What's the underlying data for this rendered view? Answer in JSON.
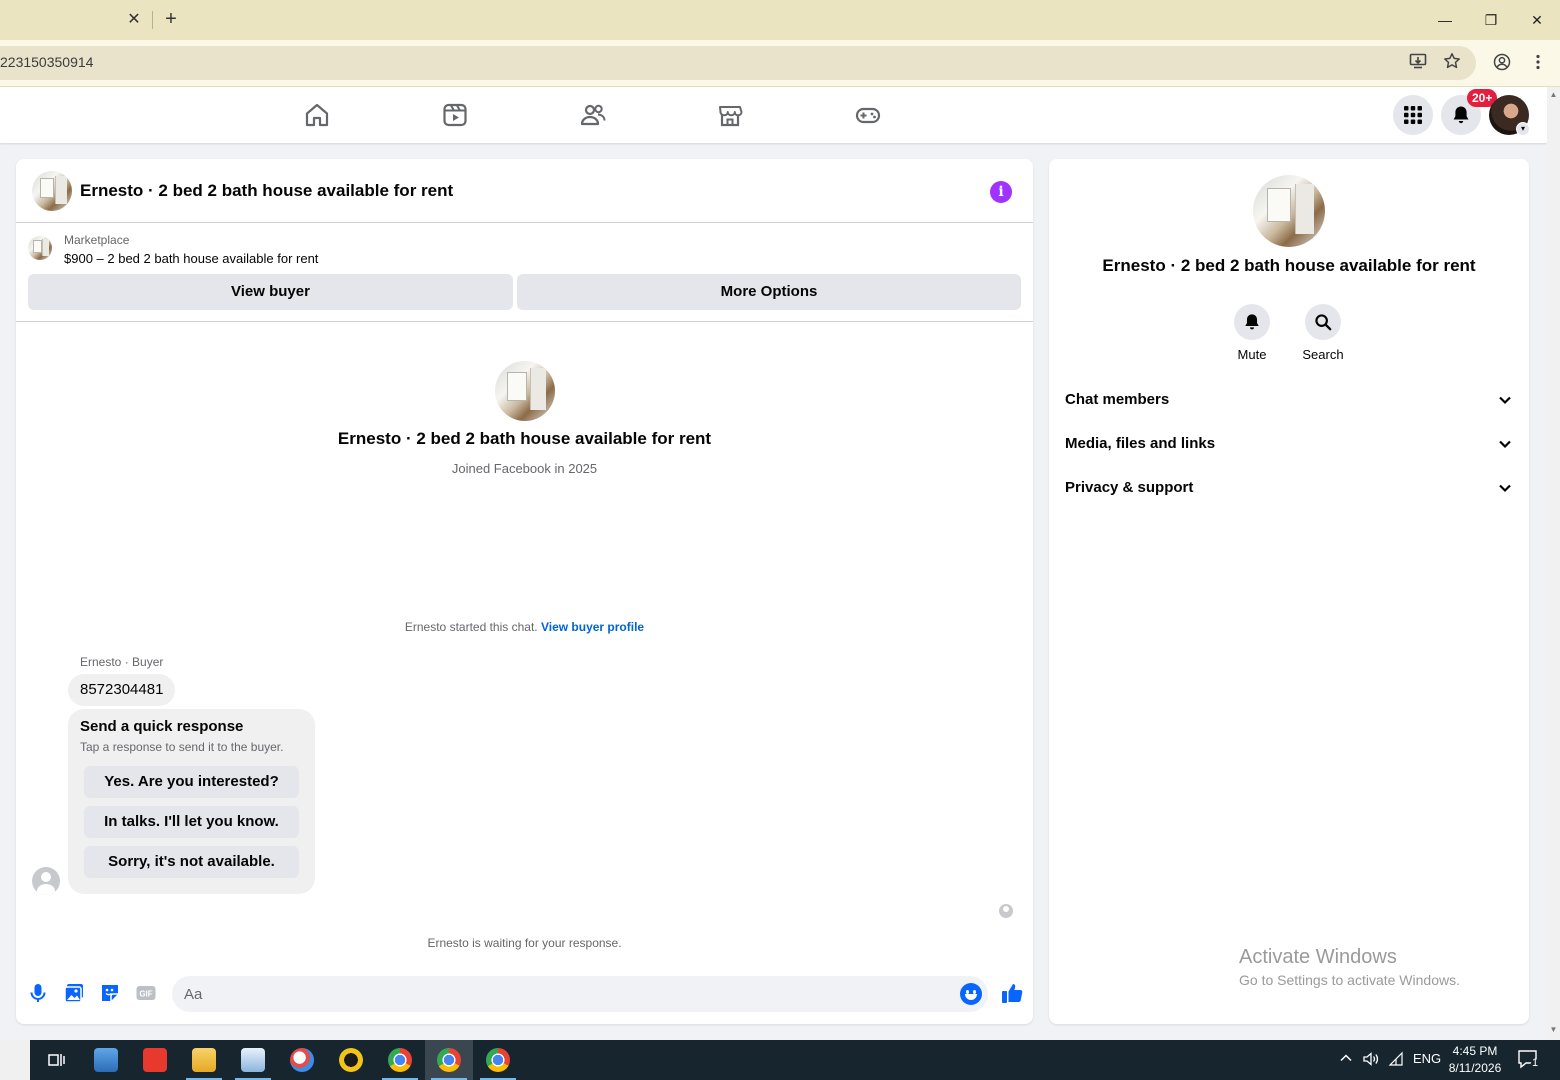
{
  "browser": {
    "url_fragment": "223150350914",
    "tab_close_glyph": "✕",
    "new_tab_glyph": "+",
    "window_controls": {
      "minimize": "—",
      "restore": "❐",
      "close": "✕"
    }
  },
  "nav": {
    "icons": [
      "home-icon",
      "video-icon",
      "friends-icon",
      "marketplace-icon",
      "gaming-icon"
    ],
    "notification_badge": "20+"
  },
  "chat": {
    "header_title": "Ernesto · 2 bed 2 bath house available for rent",
    "listing_label": "Marketplace",
    "listing_price_title": "$900 – 2 bed 2 bath house available for rent",
    "view_buyer_label": "View buyer",
    "more_options_label": "More Options",
    "intro_name": "Ernesto · 2 bed 2 bath house available for rent",
    "intro_joined": "Joined Facebook in 2025",
    "started_text": "Ernesto started this chat.",
    "view_profile_link": "View buyer profile",
    "sender_label": "Ernesto · Buyer",
    "message_text": "8572304481",
    "quick_response": {
      "title": "Send a quick response",
      "subtitle": "Tap a response to send it to the buyer.",
      "options": [
        "Yes. Are you interested?",
        "In talks. I'll let you know.",
        "Sorry, it's not available."
      ]
    },
    "waiting_text": "Ernesto is waiting for your response.",
    "input_placeholder": "Aa"
  },
  "info_panel": {
    "name": "Ernesto · 2 bed 2 bath house available for rent",
    "mute_label": "Mute",
    "search_label": "Search",
    "sections": [
      "Chat members",
      "Media, files and links",
      "Privacy & support"
    ]
  },
  "watermark": {
    "title": "Activate Windows",
    "subtitle": "Go to Settings to activate Windows."
  },
  "taskbar": {
    "language": "ENG",
    "time": "4:45 PM",
    "date": "8/11/2026",
    "notification_count": "1"
  },
  "colors": {
    "accent_blue": "#0866ff",
    "info_purple": "#a033ff",
    "badge_red": "#e41e3f",
    "tab_strip": "#ebe4c0"
  }
}
